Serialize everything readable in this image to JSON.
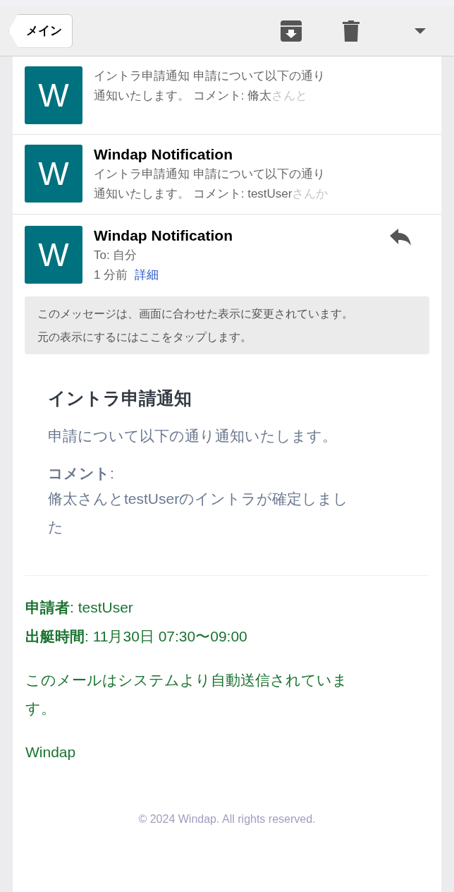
{
  "toolbar": {
    "back_button": "メイン"
  },
  "thread": [
    {
      "avatar": "W",
      "lines": [
        "イントラ申請通知 申請について以下の通り",
        "通知いたします。 コメント: 脩太"
      ],
      "faded": "さんと"
    },
    {
      "avatar": "W",
      "sender": "Windap Notification",
      "lines": [
        "イントラ申請通知 申請について以下の通り",
        "通知いたします。 コメント: testUser"
      ],
      "faded": "さんか"
    }
  ],
  "message": {
    "avatar": "W",
    "sender": "Windap Notification",
    "to": "To: 自分",
    "time": "1 分前",
    "details_link": "詳細",
    "notice": [
      "このメッセージは、画面に合わせた表示に変更されています。",
      "元の表示にするにはここをタップします。"
    ],
    "body": {
      "title": "イントラ申請通知",
      "intro": "申請について以下の通り通知いたします。",
      "comment_label": "**コメント**:",
      "comment": "脩太さんとtestUserのイントラが確定しました"
    },
    "fields": [
      "**申請者**: testUser",
      "**出艇時間**: 11月30日 07:30〜09:00"
    ],
    "auto_note": "このメールはシステムより自動送信されています。",
    "signature": "Windap",
    "copyright": "© 2024 Windap. All rights reserved."
  }
}
